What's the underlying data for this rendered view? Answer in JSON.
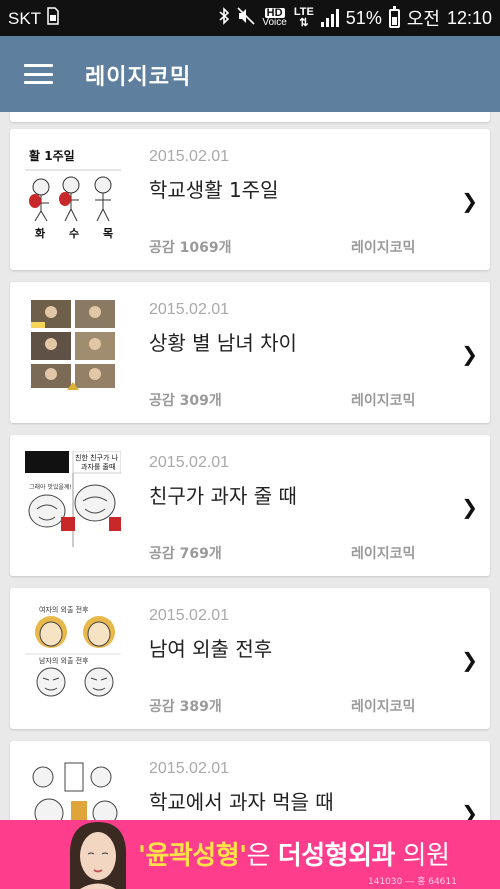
{
  "status_bar": {
    "carrier": "SKT",
    "hd_label": "HD",
    "voice_label": "Voice",
    "lte_label": "LTE",
    "battery_text": "51%",
    "battery_level": 0.51,
    "ampm": "오전",
    "time": "12:10"
  },
  "app_bar": {
    "title": "레이지코믹"
  },
  "items": [
    {
      "date": "2015.02.01",
      "title": "학교생활 1주일",
      "likes": "공감 1069개",
      "source": "레이지코믹",
      "thumb_texts": [
        "활 1주일",
        "화",
        "수",
        "목"
      ]
    },
    {
      "date": "2015.02.01",
      "title": "상황 별 남녀 차이",
      "likes": "공감 309개",
      "source": "레이지코믹"
    },
    {
      "date": "2015.02.01",
      "title": "친구가 과자 줄 때",
      "likes": "공감 769개",
      "source": "레이지코믹",
      "thumb_texts": [
        "친한 친구가 나",
        "과자를 줄때",
        "그래아 맛있을께!"
      ]
    },
    {
      "date": "2015.02.01",
      "title": "남여 외출 전후",
      "likes": "공감 389개",
      "source": "레이지코믹",
      "thumb_texts": [
        "여자의 외출 전후",
        "남자의 외출 전후"
      ]
    },
    {
      "date": "2015.02.01",
      "title": "학교에서 과자 먹을 때",
      "likes": "",
      "source": ""
    }
  ],
  "ad": {
    "quote_open": "'",
    "brand": "윤곽성형",
    "quote_close": "'",
    "middle": "은 ",
    "clinic": "더성형외과",
    "suffix": " 의원",
    "fine_print": "141030 ― 홍 64611"
  },
  "colors": {
    "app_bar": "#5e7f9e",
    "ad_background": "#ff3d8d",
    "ad_highlight": "#ffe14a"
  },
  "icons": {
    "menu": "hamburger-menu-icon",
    "chevron": "chevron-right-icon"
  }
}
